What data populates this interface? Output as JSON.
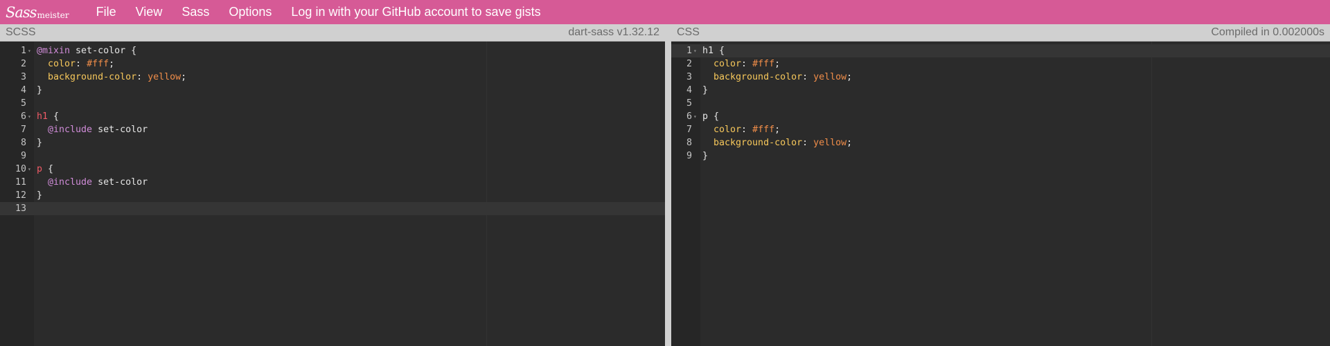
{
  "topbar": {
    "logo_script": "Sass",
    "logo_word": "meister",
    "menu": [
      "File",
      "View",
      "Sass",
      "Options",
      "Log in with your GitHub account to save gists"
    ]
  },
  "scss_pane": {
    "title": "SCSS",
    "info": "dart-sass v1.32.12",
    "lines": [
      {
        "n": "1",
        "fold": true,
        "tokens": [
          [
            "at",
            "@mixin"
          ],
          [
            "plain",
            " set-color {"
          ]
        ]
      },
      {
        "n": "2",
        "tokens": [
          [
            "plain",
            "  "
          ],
          [
            "prop",
            "color"
          ],
          [
            "plain",
            ": "
          ],
          [
            "val",
            "#fff"
          ],
          [
            "plain",
            ";"
          ]
        ]
      },
      {
        "n": "3",
        "tokens": [
          [
            "plain",
            "  "
          ],
          [
            "prop",
            "background-color"
          ],
          [
            "plain",
            ": "
          ],
          [
            "val",
            "yellow"
          ],
          [
            "plain",
            ";"
          ]
        ]
      },
      {
        "n": "4",
        "tokens": [
          [
            "plain",
            "}"
          ]
        ]
      },
      {
        "n": "5",
        "tokens": []
      },
      {
        "n": "6",
        "fold": true,
        "tokens": [
          [
            "sel",
            "h1"
          ],
          [
            "plain",
            " {"
          ]
        ]
      },
      {
        "n": "7",
        "tokens": [
          [
            "plain",
            "  "
          ],
          [
            "at",
            "@include"
          ],
          [
            "plain",
            " set-color"
          ]
        ]
      },
      {
        "n": "8",
        "tokens": [
          [
            "plain",
            "}"
          ]
        ]
      },
      {
        "n": "9",
        "tokens": []
      },
      {
        "n": "10",
        "fold": true,
        "tokens": [
          [
            "sel",
            "p"
          ],
          [
            "plain",
            " {"
          ]
        ]
      },
      {
        "n": "11",
        "tokens": [
          [
            "plain",
            "  "
          ],
          [
            "at",
            "@include"
          ],
          [
            "plain",
            " set-color"
          ]
        ]
      },
      {
        "n": "12",
        "tokens": [
          [
            "plain",
            "}"
          ]
        ]
      },
      {
        "n": "13",
        "active": true,
        "tokens": []
      }
    ]
  },
  "css_pane": {
    "title": "CSS",
    "info": "Compiled in 0.002000s",
    "lines": [
      {
        "n": "1",
        "fold": true,
        "active": true,
        "tokens": [
          [
            "plain",
            "h1 {"
          ]
        ]
      },
      {
        "n": "2",
        "tokens": [
          [
            "plain",
            "  "
          ],
          [
            "prop",
            "color"
          ],
          [
            "plain",
            ": "
          ],
          [
            "val",
            "#fff"
          ],
          [
            "plain",
            ";"
          ]
        ]
      },
      {
        "n": "3",
        "tokens": [
          [
            "plain",
            "  "
          ],
          [
            "prop",
            "background-color"
          ],
          [
            "plain",
            ": "
          ],
          [
            "val",
            "yellow"
          ],
          [
            "plain",
            ";"
          ]
        ]
      },
      {
        "n": "4",
        "tokens": [
          [
            "plain",
            "}"
          ]
        ]
      },
      {
        "n": "5",
        "tokens": []
      },
      {
        "n": "6",
        "fold": true,
        "tokens": [
          [
            "plain",
            "p {"
          ]
        ]
      },
      {
        "n": "7",
        "tokens": [
          [
            "plain",
            "  "
          ],
          [
            "prop",
            "color"
          ],
          [
            "plain",
            ": "
          ],
          [
            "val",
            "#fff"
          ],
          [
            "plain",
            ";"
          ]
        ]
      },
      {
        "n": "8",
        "tokens": [
          [
            "plain",
            "  "
          ],
          [
            "prop",
            "background-color"
          ],
          [
            "plain",
            ": "
          ],
          [
            "val",
            "yellow"
          ],
          [
            "plain",
            ";"
          ]
        ]
      },
      {
        "n": "9",
        "tokens": [
          [
            "plain",
            "}"
          ]
        ]
      }
    ]
  }
}
